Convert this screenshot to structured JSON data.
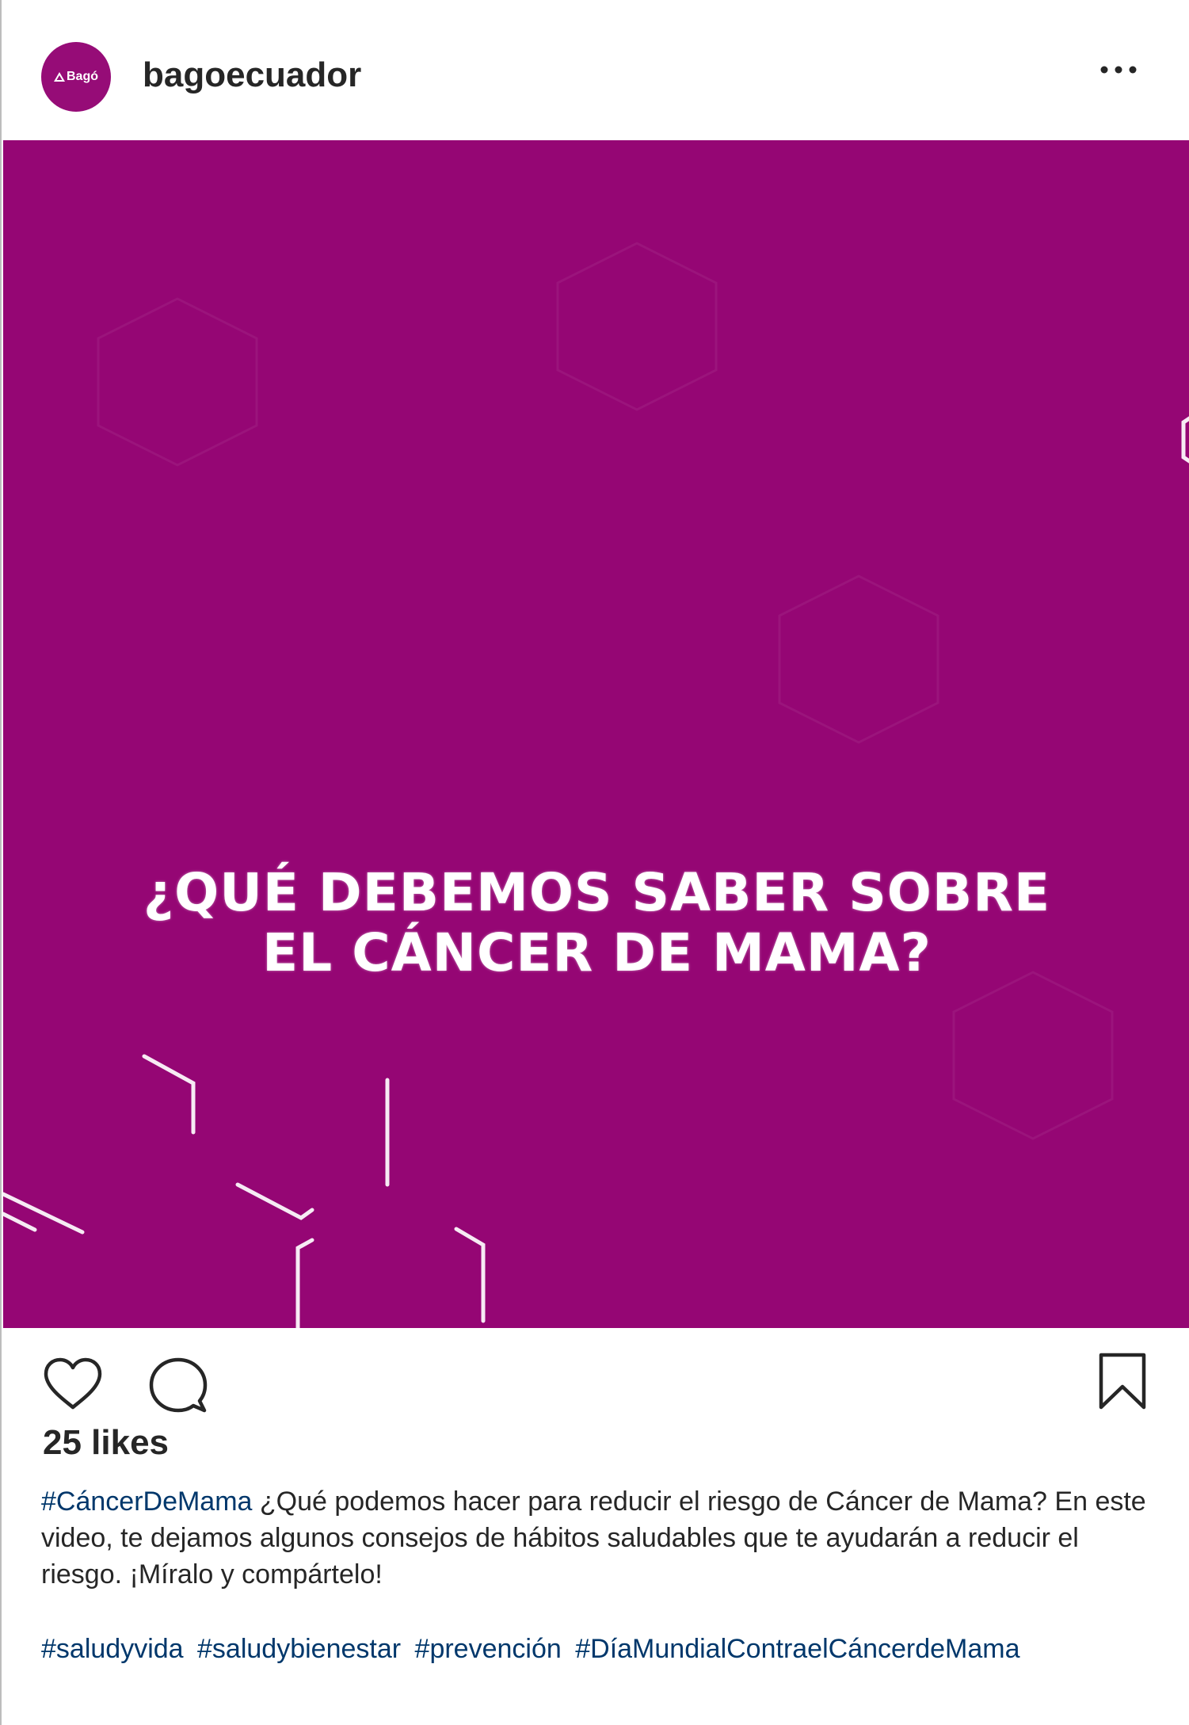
{
  "header": {
    "avatar_text": "Bagó",
    "username": "bagoecuador",
    "more_icon": "ellipsis-icon"
  },
  "media": {
    "background_color": "#950674",
    "title_line1": "¿QUÉ DEBEMOS SABER SOBRE",
    "title_line2": "EL CÁNCER DE MAMA?"
  },
  "actions": {
    "like_icon": "heart-icon",
    "comment_icon": "comment-bubble-icon",
    "save_icon": "bookmark-icon"
  },
  "likes_text": "25 likes",
  "caption": {
    "lead_hashtag": "#CáncerDeMama",
    "text": " ¿Qué podemos hacer para reducir el riesgo de Cáncer de Mama? En este video, te dejamos algunos consejos de hábitos saludables que te ayudarán a reducir el riesgo. ¡Míralo y compártelo!",
    "hashtags": [
      "#saludyvida",
      "#saludybienestar",
      "#prevención",
      "#DíaMundialContraelCáncerdeMama"
    ]
  },
  "colors": {
    "brand": "#950674",
    "link": "#00376b",
    "text": "#262626"
  }
}
